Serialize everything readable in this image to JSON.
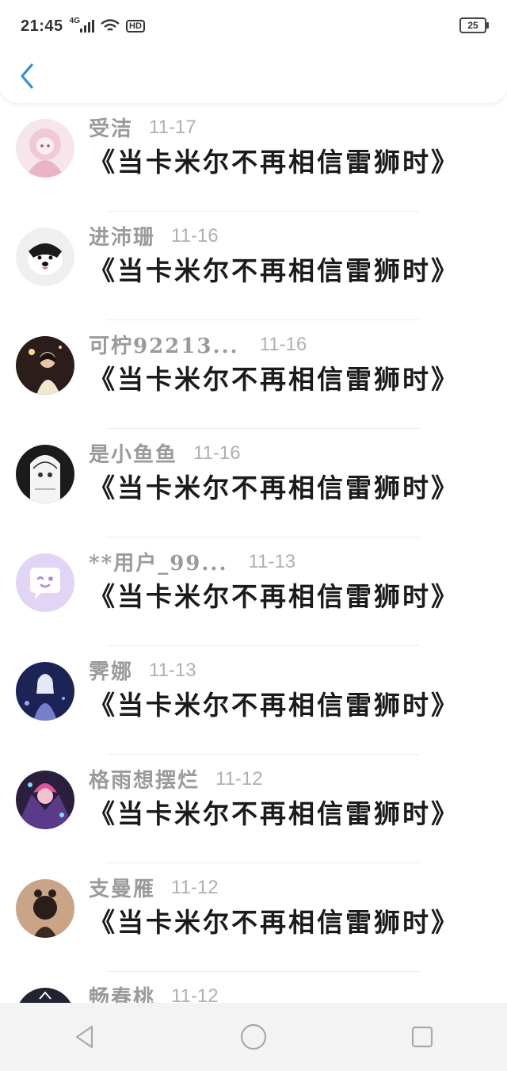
{
  "status_bar": {
    "time": "21:45",
    "network": "4G",
    "hd": "HD",
    "battery": "25"
  },
  "header": {
    "back_icon": "chevron-left-icon",
    "accent_color": "#2f8fe0"
  },
  "items": [
    {
      "name": "受洁",
      "date": "11-17",
      "title": "《当卡米尔不再相信雷狮时》"
    },
    {
      "name": "进沛珊",
      "date": "11-16",
      "title": "《当卡米尔不再相信雷狮时》"
    },
    {
      "name": "可柠92213...",
      "date": "11-16",
      "title": "《当卡米尔不再相信雷狮时》"
    },
    {
      "name": "是小鱼鱼",
      "date": "11-16",
      "title": "《当卡米尔不再相信雷狮时》"
    },
    {
      "name": "**用户_99...",
      "date": "11-13",
      "title": "《当卡米尔不再相信雷狮时》"
    },
    {
      "name": "霁娜",
      "date": "11-13",
      "title": "《当卡米尔不再相信雷狮时》"
    },
    {
      "name": "格雨想摆烂",
      "date": "11-12",
      "title": "《当卡米尔不再相信雷狮时》"
    },
    {
      "name": "支曼雁",
      "date": "11-12",
      "title": "《当卡米尔不再相信雷狮时》"
    },
    {
      "name": "畅春桃",
      "date": "11-12",
      "title": ""
    }
  ],
  "nav_bar": {
    "back_icon": "triangle-back-icon",
    "home_icon": "circle-home-icon",
    "recents_icon": "square-recents-icon"
  }
}
